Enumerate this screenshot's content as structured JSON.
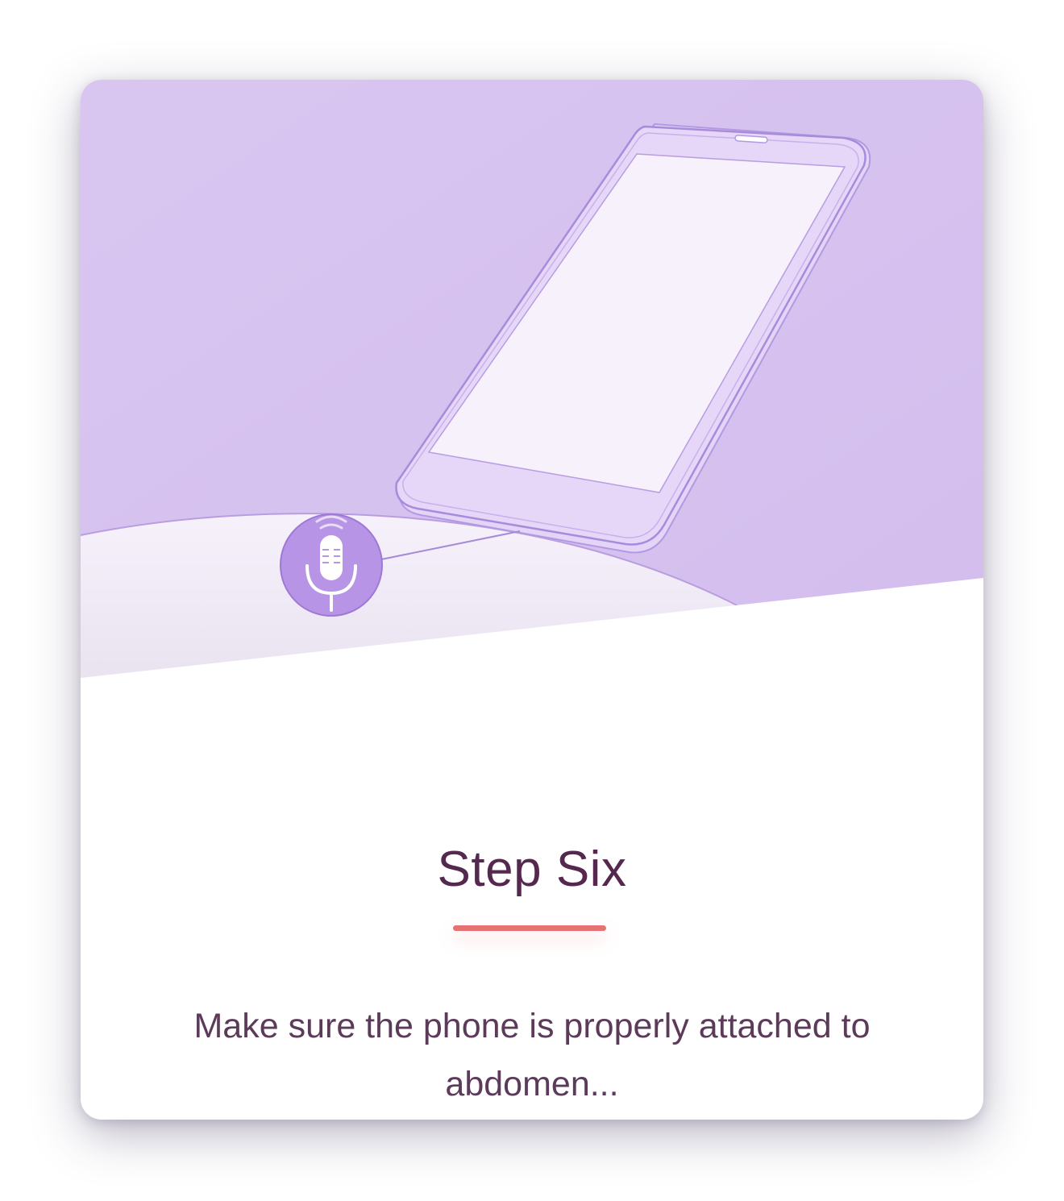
{
  "step": {
    "title": "Step Six",
    "description": "Make sure the phone is properly attached to abdomen..."
  },
  "illustration": {
    "phone_icon": "smartphone-icon",
    "microphone_icon": "microphone-icon"
  },
  "colors": {
    "title": "#55284f",
    "description": "#5c3a5a",
    "accent_rule": "#e57373",
    "illustration_background": "#d7c3ef",
    "microphone_badge": "#b794e6",
    "phone_body": "#e3d2f6",
    "phone_screen": "#f6f1fb"
  }
}
